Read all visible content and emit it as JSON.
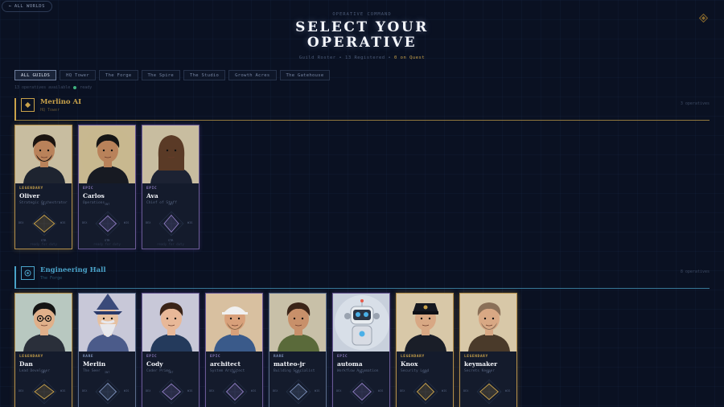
{
  "nav": {
    "back_label": "ALL WORLDS",
    "corner_icon": "diamond-icon"
  },
  "header": {
    "eyebrow": "OPERATIVE COMMAND",
    "title_line1": "SELECT YOUR",
    "title_line2": "OPERATIVE",
    "stats_text": "Guild Roster • 13 Registered • ",
    "stats_quest": "0 on Quest"
  },
  "filters": [
    {
      "label": "ALL GUILDS",
      "active": true
    },
    {
      "label": "HQ Tower",
      "active": false
    },
    {
      "label": "The Forge",
      "active": false
    },
    {
      "label": "The Spire",
      "active": false
    },
    {
      "label": "The Studio",
      "active": false
    },
    {
      "label": "Growth Acres",
      "active": false
    },
    {
      "label": "The Gatehouse",
      "active": false
    }
  ],
  "summary": {
    "text": "13 operatives available",
    "status": "ready"
  },
  "colors": {
    "gold": "#c9a24a",
    "cyan": "#4aa3c9",
    "legendary": "#c9a24a",
    "epic": "#8d7bc0",
    "rare": "#7b8fb8",
    "active_dot": "#3fb27f"
  },
  "guilds": [
    {
      "name": "Merlino AI",
      "subtitle": "HQ Tower",
      "count": "3 operatives",
      "icon": "diamond-emblem-icon",
      "accent": "#c9a24a",
      "cards": [
        {
          "name": "Oliver",
          "rarity": "LEGENDARY",
          "role": "Strategic Orchestrator",
          "avatar": "bearded-man",
          "skin": "#b9825a",
          "hair": "#1b1410",
          "outfit": "#1e2430",
          "bg": "#c8bda0",
          "stats": [
            0.7,
            0.85,
            0.7,
            0.85
          ],
          "footer": "ready for duty"
        },
        {
          "name": "Carlos",
          "rarity": "EPIC",
          "role": "Operations",
          "avatar": "man",
          "skin": "#b9825a",
          "hair": "#151515",
          "outfit": "#171a22",
          "bg": "#c8b890",
          "stats": [
            0.65,
            0.7,
            0.65,
            0.7
          ],
          "footer": "ready for duty"
        },
        {
          "name": "Ava",
          "rarity": "EPIC",
          "role": "Chief of Staff",
          "avatar": "woman",
          "skin": "#e3b08c",
          "hair": "#5a3a26",
          "outfit": "#1c2233",
          "bg": "#c8bda0",
          "stats": [
            0.7,
            0.6,
            0.7,
            0.6
          ],
          "footer": "ready for duty"
        }
      ]
    },
    {
      "name": "Engineering Hall",
      "subtitle": "The Forge",
      "count": "8 operatives",
      "icon": "target-emblem-icon",
      "accent": "#4aa3c9",
      "cards": [
        {
          "name": "Dan",
          "rarity": "LEGENDARY",
          "role": "Lead Developer",
          "avatar": "glasses-man",
          "skin": "#e0b08a",
          "hair": "#151515",
          "outfit": "#2a2f3a",
          "bg": "#b8c8c0",
          "stats": [
            0.6,
            0.8,
            0.6,
            0.8
          ],
          "footer": ""
        },
        {
          "name": "Merlin",
          "rarity": "RARE",
          "role": "The Seer",
          "avatar": "wizard",
          "skin": "#e6c0a0",
          "hair": "#e8e8ec",
          "outfit": "#4b5b8a",
          "bg": "#c8c8d8",
          "stats": [
            0.7,
            0.7,
            0.7,
            0.7
          ],
          "footer": ""
        },
        {
          "name": "Cody",
          "rarity": "EPIC",
          "role": "Coder Prime",
          "avatar": "coder",
          "skin": "#e8b898",
          "hair": "#3a2418",
          "outfit": "#243a5c",
          "bg": "#c8c8d8",
          "stats": [
            0.65,
            0.75,
            0.65,
            0.75
          ],
          "footer": ""
        },
        {
          "name": "architect",
          "rarity": "EPIC",
          "role": "System Architect",
          "avatar": "builder",
          "skin": "#d8a07a",
          "hair": "#f0f0f0",
          "outfit": "#3a5a8a",
          "bg": "#d8c0a0",
          "stats": [
            0.7,
            0.7,
            0.7,
            0.7
          ],
          "footer": ""
        },
        {
          "name": "matteo-jr",
          "rarity": "RARE",
          "role": "Building Specialist",
          "avatar": "mechanic",
          "skin": "#c8906a",
          "hair": "#3a2418",
          "outfit": "#5a6a3a",
          "bg": "#c8c0a8",
          "stats": [
            0.65,
            0.7,
            0.65,
            0.7
          ],
          "footer": ""
        },
        {
          "name": "automa",
          "rarity": "EPIC",
          "role": "Workflow Automation",
          "avatar": "robot",
          "skin": "#e8ecf0",
          "hair": "#c8ccd4",
          "outfit": "#d8dce4",
          "bg": "#c8d0dc",
          "stats": [
            0.7,
            0.75,
            0.7,
            0.75
          ],
          "footer": ""
        },
        {
          "name": "Knox",
          "rarity": "LEGENDARY",
          "role": "Security Lead",
          "avatar": "guard",
          "skin": "#d8a884",
          "hair": "#151820",
          "outfit": "#1a1e28",
          "bg": "#d8c8a8",
          "stats": [
            0.7,
            0.7,
            0.7,
            0.7
          ],
          "footer": ""
        },
        {
          "name": "keymaker",
          "rarity": "LEGENDARY",
          "role": "Secrets Keeper",
          "avatar": "keymaker",
          "skin": "#d8a884",
          "hair": "#8a7058",
          "outfit": "#4a3a2a",
          "bg": "#d8c8a8",
          "stats": [
            0.65,
            0.75,
            0.65,
            0.75
          ],
          "footer": ""
        }
      ]
    }
  ],
  "radar_labels": {
    "top": "INT",
    "left": "DEX",
    "right": "WIS",
    "bottom": "STR"
  }
}
